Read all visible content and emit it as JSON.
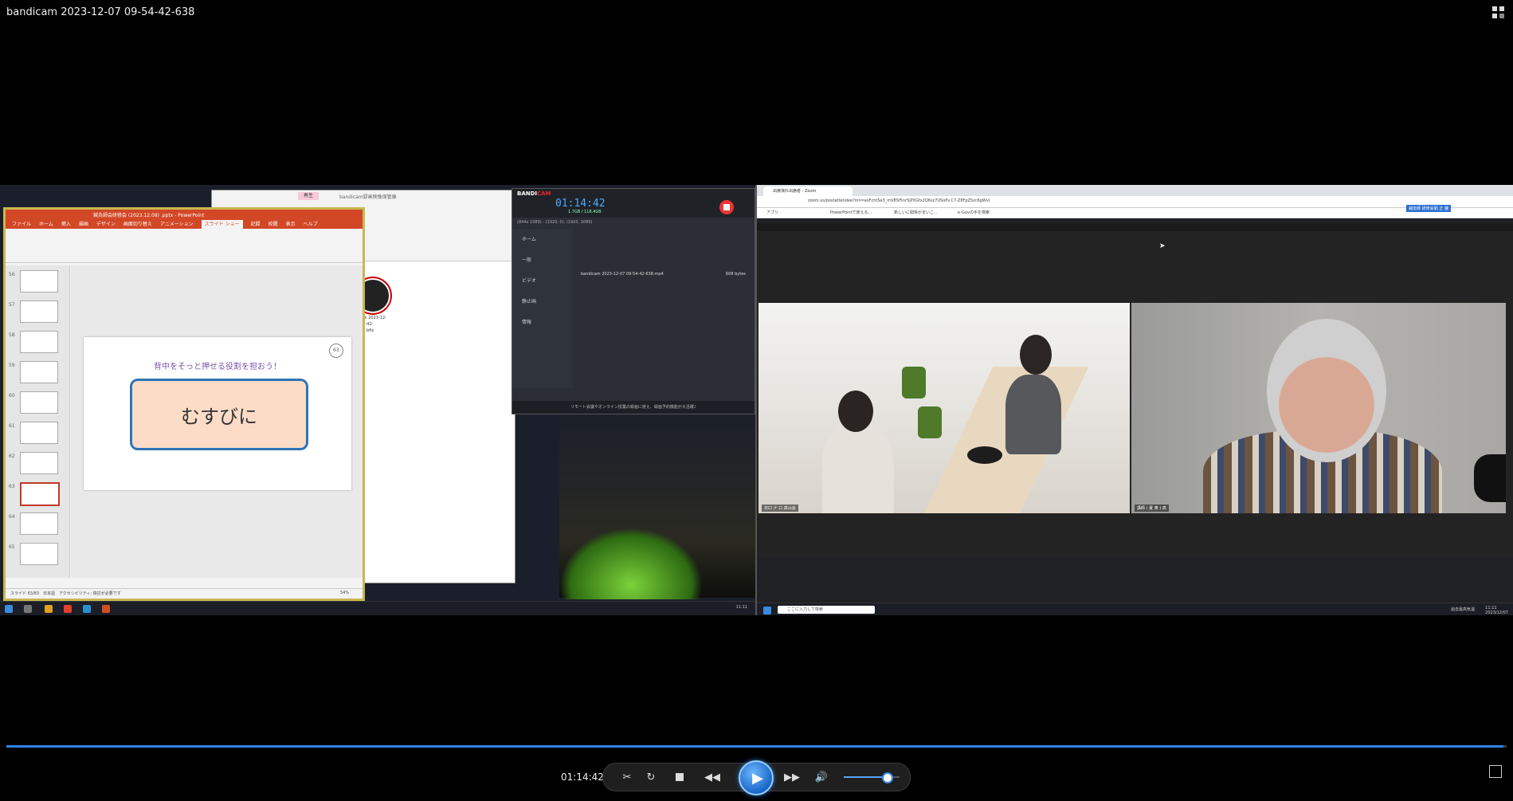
{
  "window": {
    "title": "bandicam 2023-12-07 09-54-42-638"
  },
  "recording": {
    "powerpoint": {
      "title": "鍼灸師会研修会 (2023.12.09) .pptx - PowerPoint",
      "tabs": [
        "ファイル",
        "ホーム",
        "挿入",
        "描画",
        "デザイン",
        "画面切り替え",
        "アニメーション",
        "スライド ショー",
        "記録",
        "校閲",
        "表示",
        "ヘルプ"
      ],
      "active_tab": "スライド ショー",
      "thumb_numbers": [
        "56",
        "57",
        "58",
        "59",
        "60",
        "61",
        "62",
        "63",
        "64",
        "65"
      ],
      "selected_thumb": "63",
      "slide_heading": "背中をそっと押せる役割を担おう！",
      "slide_main": "むすびに",
      "slide_badge": "63",
      "status_left": "スライド 63/83　日本語　アクセシビリティ: 検討が必要です",
      "status_zoom": "54%"
    },
    "explorer": {
      "tab": "再生",
      "title": "bandicam録画映像保管庫",
      "file_caption": "bandicam 2023-12-07 09-54-42-638.mp4.bfix"
    },
    "bandicam": {
      "brand_a": "BANDI",
      "brand_b": "CAM",
      "timer": "01:14:42",
      "timer_sub": "1.7GB / 118.4GB",
      "resolution": "(844x 1089) - (1920, 0), (1920, 1089)",
      "side_items": [
        "ホーム",
        "一般",
        "ビデオ",
        "静止画",
        "情報"
      ],
      "filename": "bandicam 2023-12-07 09-54-42-638.mp4",
      "filesize": "608 bytes",
      "footer": "リモート会議やオンライン授業の録画に使え、録画予約機能が大活躍♪"
    },
    "browser": {
      "tab_title": "出席演れ出席者 - Zoom",
      "url": "zoom.us/postattendee?mn=esFchtSe3_mV8Sf5nr5jPXGfx2Q6sz7USoPv.C7-Z8FpZSzc6gWvi",
      "bookmarks": [
        "アプリ",
        "PowerPointで使える...",
        "新しいに関係がまいこ...",
        "e-Govの手を検索"
      ],
      "badge": "鍼灸師 研修会勤 正 課",
      "video1_label": "日口 ナ ロ 高山会",
      "video2_label": "講師 ( 夏 奥 ) 高"
    },
    "taskbar": {
      "search_placeholder": "ここに入力して検索",
      "weather": "過去最高気温",
      "clock_time": "11:11",
      "clock_date": "2023/12/07",
      "left_clock": "11:11"
    }
  },
  "player": {
    "current_time": "01:14:42",
    "progress": 0.998,
    "volume": 0.75,
    "icons": [
      "screen-capture-icon",
      "repeat-icon",
      "stop-icon",
      "rewind-icon",
      "play-icon",
      "fast-forward-icon",
      "volume-icon"
    ]
  }
}
